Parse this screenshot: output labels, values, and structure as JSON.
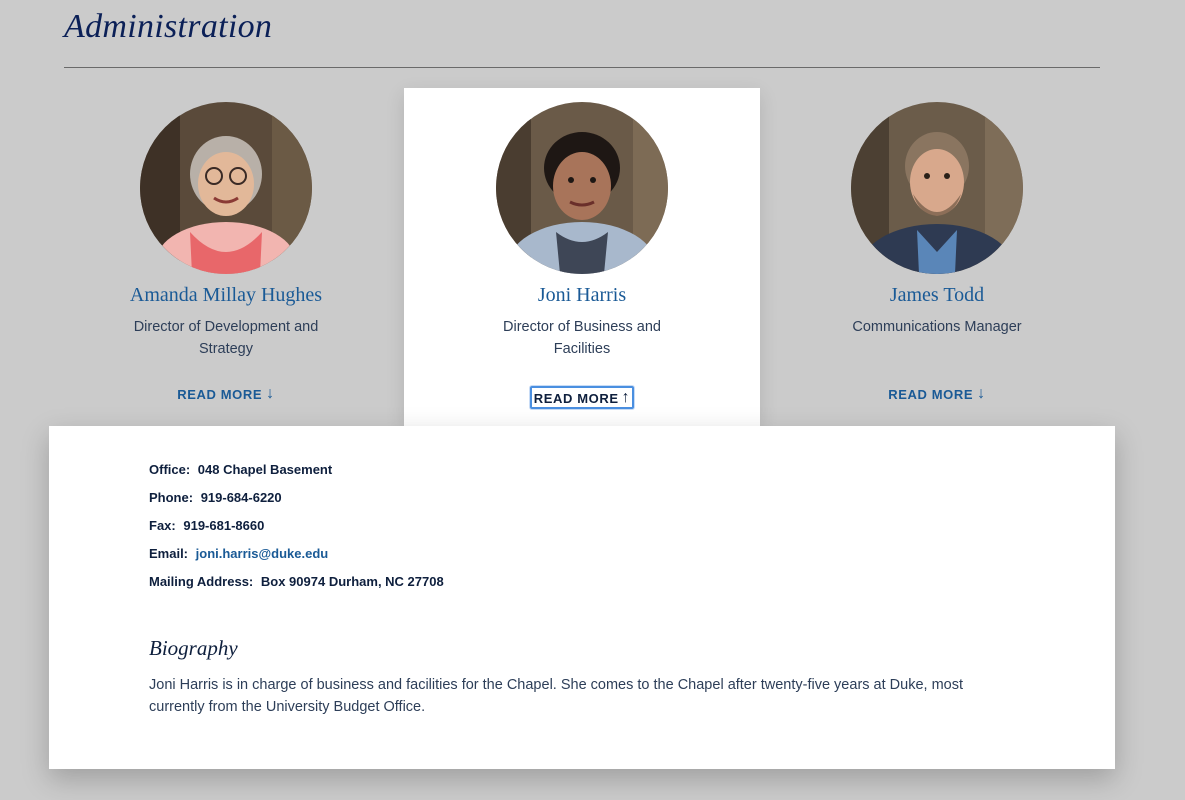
{
  "section": {
    "title": "Administration"
  },
  "people": [
    {
      "name": "Amanda Millay Hughes",
      "role": "Director of Development and Strategy",
      "read_more": "READ MORE",
      "arrow": "↓",
      "icon": "arrow-down-icon"
    },
    {
      "name": "Joni Harris",
      "role": "Director of Business and Facilities",
      "read_more": "READ MORE",
      "arrow": "↑",
      "icon": "arrow-up-icon"
    },
    {
      "name": "James Todd",
      "role": "Communications Manager",
      "read_more": "READ MORE",
      "arrow": "↓",
      "icon": "arrow-down-icon"
    }
  ],
  "details": {
    "office_label": "Office:",
    "office": "048 Chapel Basement",
    "phone_label": "Phone:",
    "phone": "919-684-6220",
    "fax_label": "Fax:",
    "fax": "919-681-8660",
    "email_label": "Email:",
    "email": "joni.harris@duke.edu",
    "mailing_label": "Mailing Address:",
    "mailing": "Box 90974 Durham, NC 27708",
    "bio_heading": "Biography",
    "bio": "Joni Harris is in charge of business and facilities for the Chapel. She comes to the Chapel after twenty-five years at Duke, most currently from the University Budget Office."
  },
  "colors": {
    "background": "#cbcbcb",
    "link": "#1a5a96",
    "navy": "#012169",
    "focus": "#4a8fe0"
  }
}
